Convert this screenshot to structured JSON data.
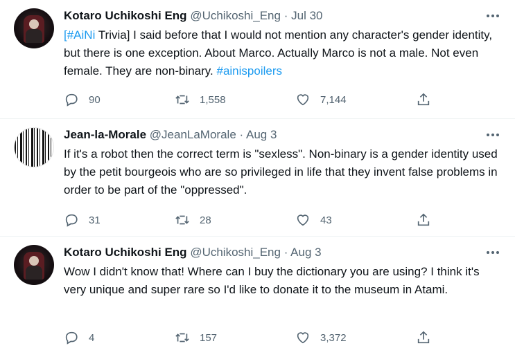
{
  "tweets": [
    {
      "name": "Kotaro Uchikoshi Eng",
      "handle": "@Uchikoshi_Eng",
      "separator": "·",
      "date": "Jul 30",
      "text": {
        "hashtag1": "[#AiNi",
        "part1": " Trivia] I said before that I would not mention any character's gender identity, but there is one exception. About Marco. Actually Marco is not a male. Not even female. They are non-binary. ",
        "hashtag2": "#ainispoilers"
      },
      "replies": "90",
      "retweets": "1,558",
      "likes": "7,144"
    },
    {
      "name": "Jean-la-Morale",
      "handle": "@JeanLaMorale",
      "separator": "·",
      "date": "Aug 3",
      "text": "If it's a robot then the correct term is \"sexless\". Non-binary is a gender identity used by the petit bourgeois who are so privileged in life that they invent false problems in order to be part of the \"oppressed\".",
      "replies": "31",
      "retweets": "28",
      "likes": "43"
    },
    {
      "name": "Kotaro Uchikoshi Eng",
      "handle": "@Uchikoshi_Eng",
      "separator": "·",
      "date": "Aug 3",
      "text": "Wow I didn't know that! Where can I buy the dictionary you are using? I think it's very unique and super rare so I'd like to donate it to the museum in Atami.",
      "replies": "4",
      "retweets": "157",
      "likes": "3,372"
    }
  ],
  "icons": {
    "reply": "reply-icon",
    "retweet": "retweet-icon",
    "like": "heart-icon",
    "share": "share-icon",
    "more": "more-icon"
  },
  "colors": {
    "link": "#1d9bf0",
    "secondary": "#536471",
    "text": "#0f1419"
  }
}
